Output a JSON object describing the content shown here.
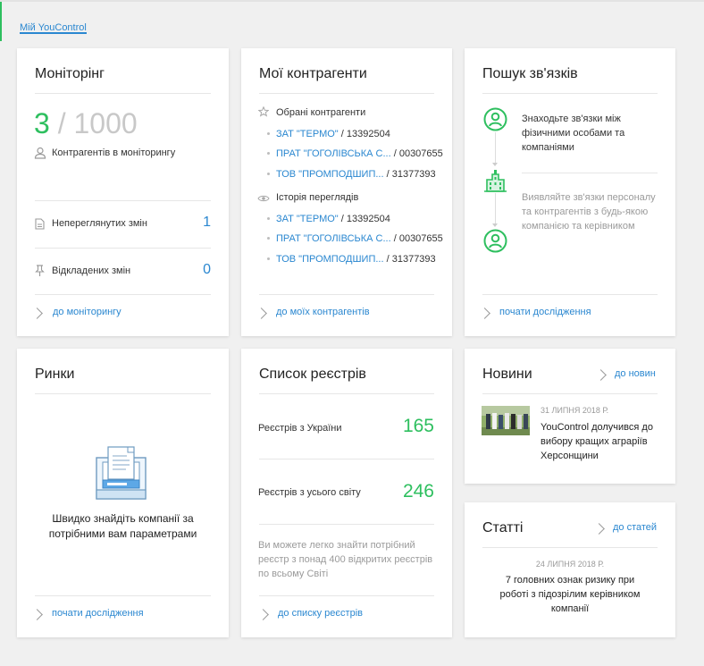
{
  "breadcrumb": "Мій YouControl",
  "monitoring": {
    "title": "Моніторінг",
    "count": "3",
    "sep": "/",
    "limit": "1000",
    "subtitle": "Контрагентів в моніторингу",
    "unviewed_label": "Непереглянутих змін",
    "unviewed_value": "1",
    "deferred_label": "Відкладених змін",
    "deferred_value": "0",
    "link": "до моніторингу"
  },
  "counterparties": {
    "title": "Мої контрагенти",
    "favorites_label": "Обрані контрагенти",
    "favorites": [
      {
        "name": "ЗАТ \"ТЕРМО\"",
        "code": "/ 13392504"
      },
      {
        "name": "ПРАТ \"ГОГОЛІВСЬКА С...",
        "code": "/ 00307655"
      },
      {
        "name": "ТОВ \"ПРОМПОДШИП...",
        "code": "/ 31377393"
      }
    ],
    "history_label": "Історія переглядів",
    "history": [
      {
        "name": "ЗАТ \"ТЕРМО\"",
        "code": "/ 13392504"
      },
      {
        "name": "ПРАТ \"ГОГОЛІВСЬКА С...",
        "code": "/ 00307655"
      },
      {
        "name": "ТОВ \"ПРОМПОДШИП...",
        "code": "/ 31377393"
      }
    ],
    "link": "до моїх контрагентів"
  },
  "links_search": {
    "title": "Пошук зв'язків",
    "text1": "Знаходьте зв'язки між фізичними особами та компаніями",
    "text2": "Виявляйте зв'язки персоналу та контрагентів з будь-якою компанією та керівником",
    "link": "почати дослідження"
  },
  "markets": {
    "title": "Ринки",
    "text": "Швидко знайдіть компанії за потрібними вам параметрами",
    "link": "почати дослідження"
  },
  "registries": {
    "title": "Список реєстрів",
    "ukraine_label": "Реєстрів з України",
    "ukraine_value": "165",
    "world_label": "Реєстрів з усього світу",
    "world_value": "246",
    "note": "Ви можете легко знайти потрібний реєстр з понад 400 відкритих реєстрів по всьому Світі",
    "link": "до списку реєстрів"
  },
  "news": {
    "title": "Новини",
    "link": "до новин",
    "date": "31 ЛИПНЯ 2018 Р.",
    "headline": "YouControl долучився до вибору кращих аграріїв Херсонщини"
  },
  "articles": {
    "title": "Статті",
    "link": "до статей",
    "date": "24 ЛИПНЯ 2018 Р.",
    "headline": "7 головних ознак ризику при роботі з підозрілим керівником компанії"
  },
  "colors": {
    "accent_green": "#2ebf5f",
    "link_blue": "#2a87d0",
    "background": "#f0f0f0"
  }
}
